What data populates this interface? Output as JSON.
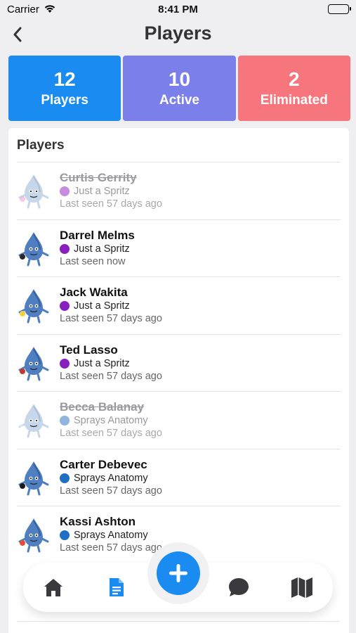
{
  "status_bar": {
    "carrier": "Carrier",
    "time": "8:41 PM"
  },
  "nav": {
    "title": "Players",
    "back_icon": "chevron-left-icon"
  },
  "stats": [
    {
      "value": "12",
      "label": "Players",
      "color": "#1a8bf0"
    },
    {
      "value": "10",
      "label": "Active",
      "color": "#7b7fea"
    },
    {
      "value": "2",
      "label": "Eliminated",
      "color": "#f7767d"
    }
  ],
  "list": {
    "title": "Players",
    "players": [
      {
        "name": "Curtis Gerrity",
        "team": "Just a Spritz",
        "team_color": "#c88be0",
        "last_seen": "Last seen 57 days ago",
        "eliminated": true
      },
      {
        "name": "Darrel Melms",
        "team": "Just a Spritz",
        "team_color": "#8a1fc0",
        "last_seen": "Last seen now",
        "eliminated": false
      },
      {
        "name": "Jack Wakita",
        "team": "Just a Spritz",
        "team_color": "#8a1fc0",
        "last_seen": "Last seen 57 days ago",
        "eliminated": false
      },
      {
        "name": "Ted Lasso",
        "team": "Just a Spritz",
        "team_color": "#8a1fc0",
        "last_seen": "Last seen 57 days ago",
        "eliminated": false
      },
      {
        "name": "Becca Balanay",
        "team": "Sprays Anatomy",
        "team_color": "#8fb6dd",
        "last_seen": "Last seen 57 days ago",
        "eliminated": true
      },
      {
        "name": "Carter Debevec",
        "team": "Sprays Anatomy",
        "team_color": "#1f6fc4",
        "last_seen": "Last seen 57 days ago",
        "eliminated": false
      },
      {
        "name": "Kassi Ashton",
        "team": "Sprays Anatomy",
        "team_color": "#1f6fc4",
        "last_seen": "Last seen 57 days ago",
        "eliminated": false
      }
    ]
  },
  "tabbar": {
    "tabs": [
      "home-icon",
      "document-icon",
      "chat-icon",
      "map-icon"
    ],
    "active": "document-icon",
    "add_icon": "plus-icon"
  }
}
